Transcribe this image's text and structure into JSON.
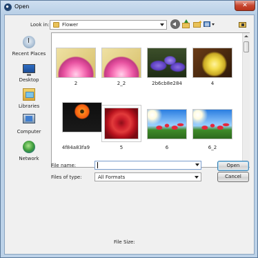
{
  "window": {
    "title": "Open",
    "close_label": "✕"
  },
  "toolbar": {
    "look_in_label": "Look in:",
    "look_in_value": "Flower"
  },
  "places": [
    {
      "label": "Recent Places",
      "icon": "recent-places-icon"
    },
    {
      "label": "Desktop",
      "icon": "desktop-icon"
    },
    {
      "label": "Libraries",
      "icon": "libraries-icon"
    },
    {
      "label": "Computer",
      "icon": "computer-icon"
    },
    {
      "label": "Network",
      "icon": "network-icon"
    }
  ],
  "files": [
    {
      "name": "2"
    },
    {
      "name": "2_2"
    },
    {
      "name": "2b6cb8e284"
    },
    {
      "name": "4"
    },
    {
      "name": "4f84a83fa9"
    },
    {
      "name": "5"
    },
    {
      "name": "6"
    },
    {
      "name": "6_2"
    }
  ],
  "form": {
    "file_name_label": "File name:",
    "file_name_value": "",
    "files_of_type_label": "Files of type:",
    "files_of_type_value": "All Formats",
    "open_label": "Open",
    "cancel_label": "Cancel",
    "file_size_label": "File Size:"
  }
}
